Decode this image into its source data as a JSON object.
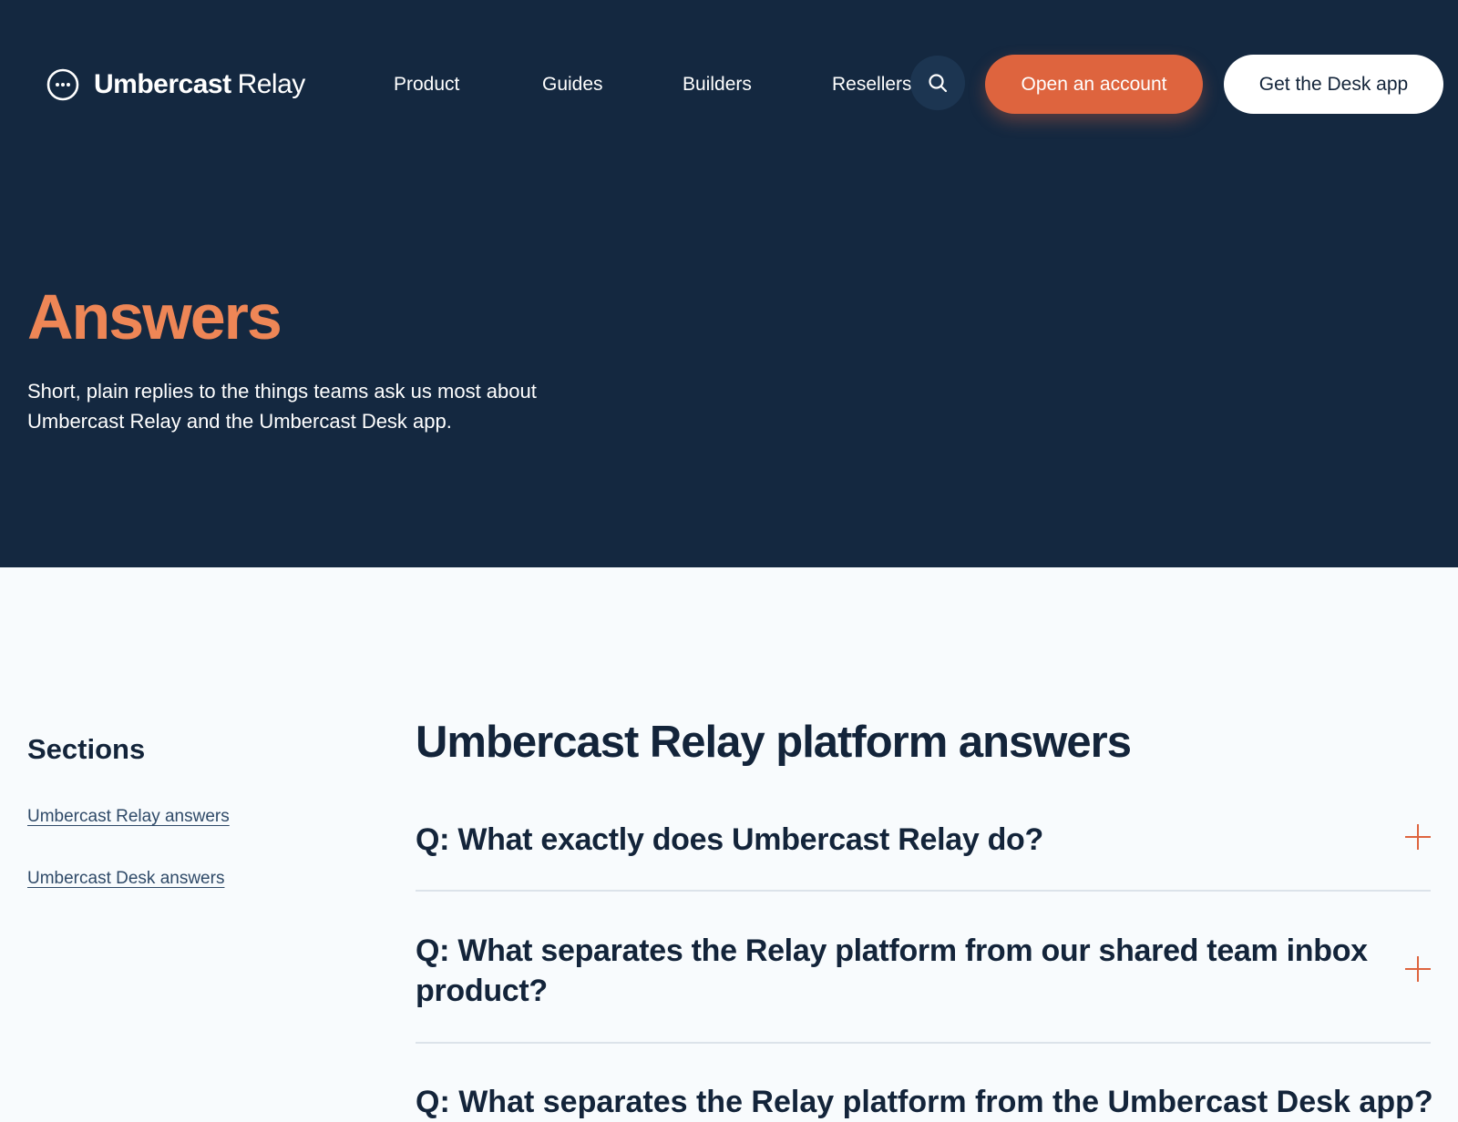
{
  "brand": {
    "name_bold": "Umbercast",
    "name_light": "Relay",
    "icon": "ellipsis-circle-icon"
  },
  "nav": {
    "links": [
      "Product",
      "Guides",
      "Builders",
      "Resellers"
    ],
    "search_icon": "search-icon",
    "cta_primary": "Open an account",
    "cta_secondary": "Get the Desk app"
  },
  "hero": {
    "title": "Answers",
    "description": "Short, plain replies to the things teams ask us most about Umbercast Relay and the Umbercast Desk app."
  },
  "sidebar": {
    "title": "Sections",
    "links": [
      "Umbercast Relay answers",
      "Umbercast Desk answers"
    ]
  },
  "main": {
    "title": "Umbercast Relay platform answers",
    "faqs": [
      {
        "question": "Q: What exactly does Umbercast Relay do?",
        "toggle_icon": "plus-icon"
      },
      {
        "question": "Q: What separates the Relay platform from our shared team inbox product?",
        "toggle_icon": "plus-icon"
      },
      {
        "question": "Q: What separates the Relay platform from the Umbercast Desk app?",
        "toggle_icon": "plus-icon"
      }
    ]
  },
  "colors": {
    "hero_background": "#142840",
    "accent": "#de643e",
    "title_accent": "#ee8656",
    "page_background": "#f8fbfd",
    "text_dark": "#13243a"
  }
}
